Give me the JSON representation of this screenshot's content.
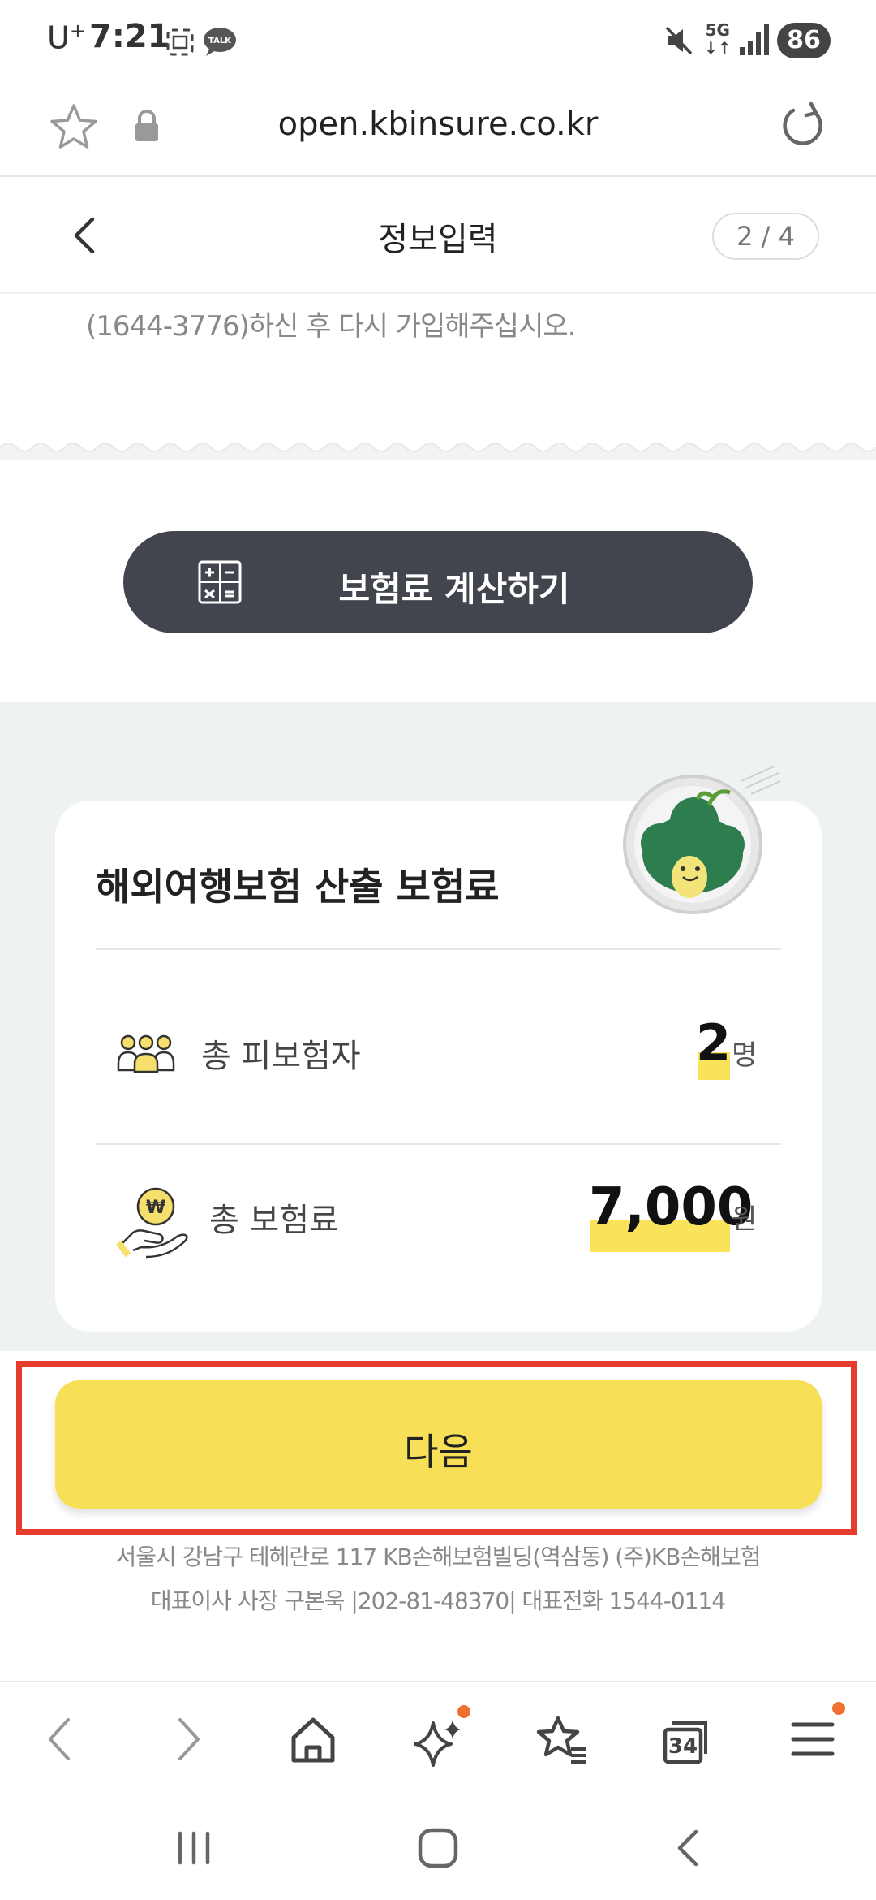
{
  "status_bar": {
    "carrier": "U",
    "carrier_sup": "+",
    "time": "7:21",
    "battery": "86",
    "network": "5G"
  },
  "browser": {
    "url": "open.kbinsure.co.kr",
    "tab_count": "34"
  },
  "header": {
    "title": "정보입력",
    "step": "2 / 4"
  },
  "notice": "(1644-3776)하신 후 다시 가입해주십시오.",
  "calc_button": {
    "label": "보험료 계산하기"
  },
  "result_card": {
    "title": "해외여행보험 산출 보험료",
    "insured": {
      "label": "총 피보험자",
      "value": "2",
      "unit": "명"
    },
    "premium": {
      "label": "총 보험료",
      "value": "7,000",
      "unit": "원"
    }
  },
  "next_button": {
    "label": "다음"
  },
  "footer": {
    "line1": "서울시 강남구 테헤란로 117 KB손해보험빌딩(역삼동) (주)KB손해보험",
    "line2": "대표이사 사장 구본욱 |202-81-48370| 대표전화 1544-0114"
  },
  "colors": {
    "accent_yellow": "#f8df58",
    "dark_button": "#42444e",
    "highlight_border": "#e53c2e",
    "section_bg": "#eff2f3"
  }
}
